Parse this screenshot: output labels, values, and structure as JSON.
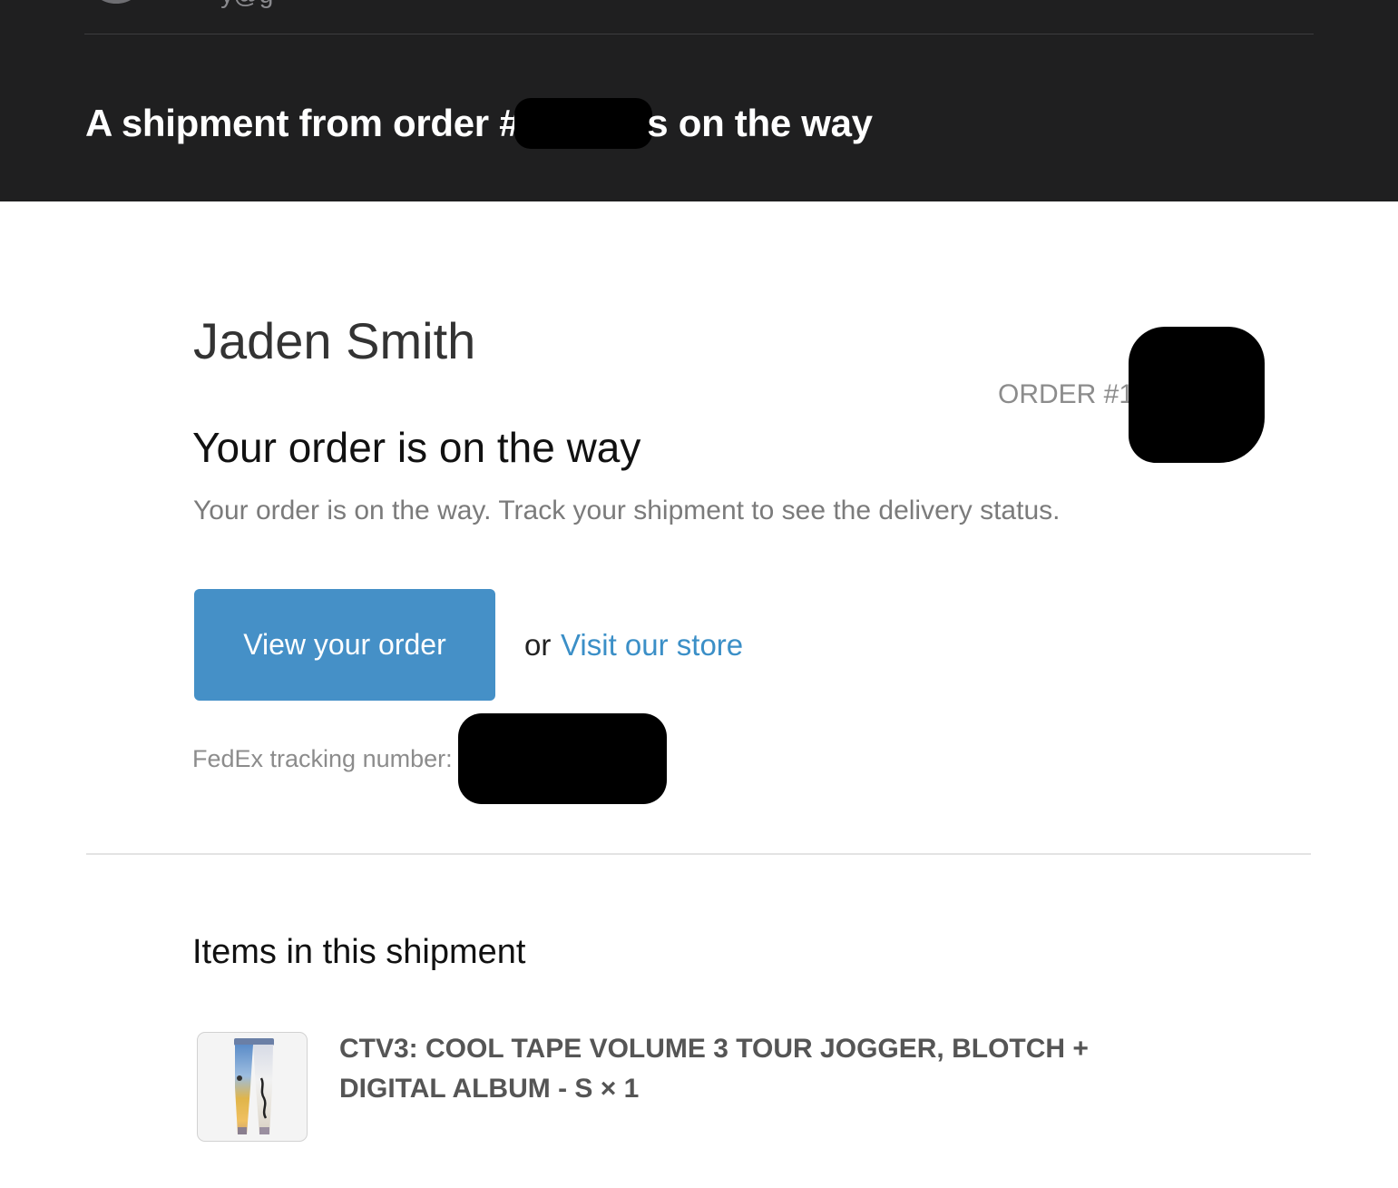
{
  "header": {
    "sender_email": "·······y@g",
    "subject_prefix": "A shipment from order #",
    "subject_suffix": "s on the way"
  },
  "customer": {
    "name": "Jaden Smith"
  },
  "order": {
    "label": "ORDER #1",
    "heading": "Your order is on the way",
    "message": "Your order is on the way. Track your shipment to see the delivery status."
  },
  "actions": {
    "view_order_label": "View your order",
    "or_text": "or",
    "store_link_label": "Visit our store"
  },
  "tracking": {
    "label": "FedEx tracking number:"
  },
  "shipment": {
    "heading": "Items in this shipment",
    "items": [
      {
        "title": "CTV3: COOL TAPE VOLUME 3 TOUR JOGGER, BLOTCH + DIGITAL ALBUM - S × 1",
        "image_icon": "tie-dye-jogger-thumbnail"
      }
    ]
  },
  "colors": {
    "header_bg": "#1f1f20",
    "button_bg": "#4590c7",
    "link": "#3b8fc7",
    "redaction": "#000000"
  }
}
